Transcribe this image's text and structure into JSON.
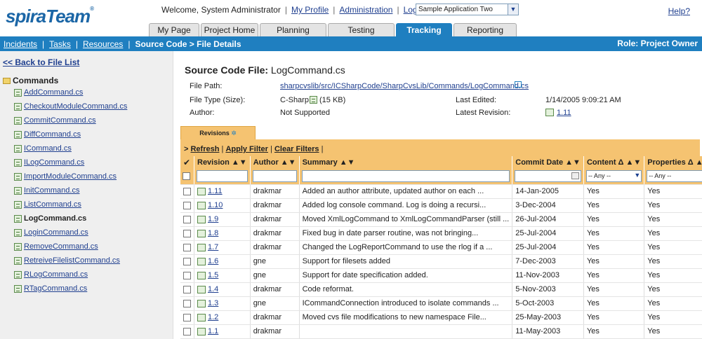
{
  "header": {
    "logo_main": "spira",
    "logo_team": "Team",
    "logo_mark": "®",
    "welcome": "Welcome, System Administrator",
    "my_profile": "My Profile",
    "administration": "Administration",
    "logout": "Log Out",
    "project_select": "Sample Application Two",
    "help": "Help?"
  },
  "tabs": [
    "My Page",
    "Project Home",
    "Planning",
    "Testing",
    "Tracking",
    "Reporting"
  ],
  "active_tab": "Tracking",
  "nav": {
    "incidents": "Incidents",
    "tasks": "Tasks",
    "resources": "Resources",
    "current": "Source Code > File Details",
    "role": "Role: Project Owner"
  },
  "sidebar": {
    "back": "<< Back to File List",
    "folder": "Commands",
    "files": [
      "AddCommand.cs",
      "CheckoutModuleCommand.cs",
      "CommitCommand.cs",
      "DiffCommand.cs",
      "ICommand.cs",
      "ILogCommand.cs",
      "ImportModuleCommand.cs",
      "InitCommand.cs",
      "ListCommand.cs",
      "LogCommand.cs",
      "LoginCommand.cs",
      "RemoveCommand.cs",
      "RetreiveFilelistCommand.cs",
      "RLogCommand.cs",
      "RTagCommand.cs"
    ],
    "selected_file": "LogCommand.cs"
  },
  "details": {
    "title_label": "Source Code File:",
    "title_value": "LogCommand.cs",
    "file_path_label": "File Path:",
    "file_path": "sharpcvslib/src/ICSharpCode/SharpCvsLib/Commands/LogCommand.cs",
    "file_type_label": "File Type (Size):",
    "file_type": "C-Sharp",
    "file_size": "(15 KB)",
    "author_label": "Author:",
    "author": "Not Supported",
    "last_edited_label": "Last Edited:",
    "last_edited": "1/14/2005 9:09:21 AM",
    "latest_revision_label": "Latest Revision:",
    "latest_revision": "1.11"
  },
  "revisions_tab": "Revisions",
  "toolbar": {
    "refresh": "Refresh",
    "apply_filter": "Apply Filter",
    "clear_filters": "Clear Filters"
  },
  "columns": {
    "revision": "Revision ▲▼",
    "author": "Author ▲▼",
    "summary": "Summary ▲▼",
    "commit_date": "Commit Date ▲▼",
    "content": "Content Δ ▲▼",
    "properties": "Properties Δ ▲▼"
  },
  "filters": {
    "content_any": "-- Any --",
    "properties_any": "-- Any --"
  },
  "rows": [
    {
      "revision": "1.11",
      "author": "drakmar",
      "summary": "Added an author attribute, updated author on each ...",
      "date": "14-Jan-2005",
      "content": "Yes",
      "properties": "Yes"
    },
    {
      "revision": "1.10",
      "author": "drakmar",
      "summary": "Added log console command.  Log is doing a recursi...",
      "date": "3-Dec-2004",
      "content": "Yes",
      "properties": "Yes"
    },
    {
      "revision": "1.9",
      "author": "drakmar",
      "summary": "Moved XmlLogCommand to XmlLogCommandParser (still ...",
      "date": "26-Jul-2004",
      "content": "Yes",
      "properties": "Yes"
    },
    {
      "revision": "1.8",
      "author": "drakmar",
      "summary": "Fixed bug in date parser routine, was not bringing...",
      "date": "25-Jul-2004",
      "content": "Yes",
      "properties": "Yes"
    },
    {
      "revision": "1.7",
      "author": "drakmar",
      "summary": "Changed the LogReportCommand to use the rlog if a ...",
      "date": "25-Jul-2004",
      "content": "Yes",
      "properties": "Yes"
    },
    {
      "revision": "1.6",
      "author": "gne",
      "summary": "Support for filesets added",
      "date": "7-Dec-2003",
      "content": "Yes",
      "properties": "Yes"
    },
    {
      "revision": "1.5",
      "author": "gne",
      "summary": "Support for date specification added.",
      "date": "11-Nov-2003",
      "content": "Yes",
      "properties": "Yes"
    },
    {
      "revision": "1.4",
      "author": "drakmar",
      "summary": "Code reformat.",
      "date": "5-Nov-2003",
      "content": "Yes",
      "properties": "Yes"
    },
    {
      "revision": "1.3",
      "author": "gne",
      "summary": "ICommandConnection introduced to isolate commands ...",
      "date": "5-Oct-2003",
      "content": "Yes",
      "properties": "Yes"
    },
    {
      "revision": "1.2",
      "author": "drakmar",
      "summary": "Moved cvs file modifications to new namespace File...",
      "date": "25-May-2003",
      "content": "Yes",
      "properties": "Yes"
    },
    {
      "revision": "1.1",
      "author": "drakmar",
      "summary": "",
      "date": "11-May-2003",
      "content": "Yes",
      "properties": "Yes"
    }
  ]
}
